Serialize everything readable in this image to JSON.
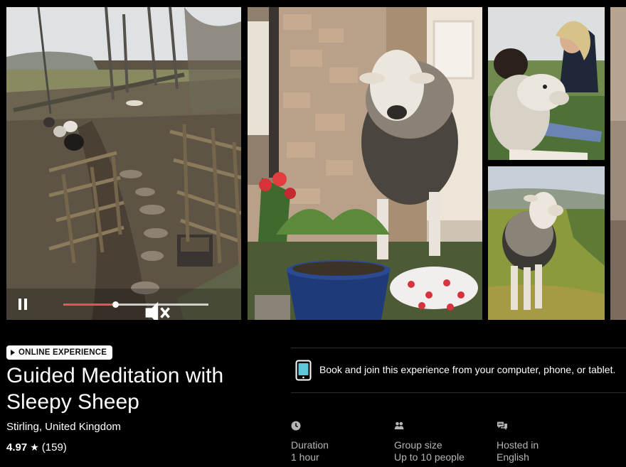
{
  "video": {
    "progress_fraction": 0.36
  },
  "experience": {
    "badge": "ONLINE EXPERIENCE",
    "title": "Guided Meditation with Sleepy Sheep",
    "location": "Stirling, United Kingdom",
    "rating": "4.97",
    "rating_star": "★",
    "review_count": "(159)"
  },
  "booking": {
    "device_text": "Book and join this experience from your computer, phone, or tablet."
  },
  "details": [
    {
      "icon": "clock-icon",
      "label": "Duration",
      "value": "1 hour"
    },
    {
      "icon": "people-icon",
      "label": "Group size",
      "value": "Up to 10 people"
    },
    {
      "icon": "chat-bubbles-icon",
      "label": "Hosted in",
      "value": "English"
    }
  ],
  "colors": {
    "background": "#000000",
    "progress_fill": "#e0565b",
    "muted_text": "#b5b5b5"
  }
}
